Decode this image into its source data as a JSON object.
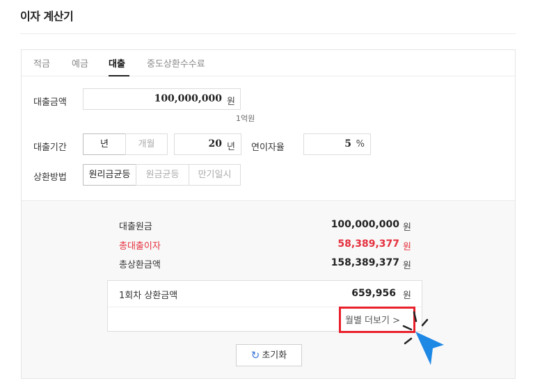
{
  "page": {
    "title": "이자 계산기"
  },
  "tabs": [
    {
      "label": "적금"
    },
    {
      "label": "예금"
    },
    {
      "label": "대출"
    },
    {
      "label": "중도상환수수료"
    }
  ],
  "form": {
    "amount": {
      "label": "대출금액",
      "value": "100,000,000",
      "unit": "원",
      "hint": "1억원"
    },
    "period": {
      "label": "대출기간",
      "unit_options": [
        "년",
        "개월"
      ],
      "selected_unit": "년",
      "value": "20",
      "unit": "년"
    },
    "rate": {
      "label": "연이자율",
      "value": "5",
      "unit": "%"
    },
    "method": {
      "label": "상환방법",
      "options": [
        "원리금균등",
        "원금균등",
        "만기일시"
      ],
      "selected": "원리금균등"
    }
  },
  "result": {
    "principal": {
      "label": "대출원금",
      "value": "100,000,000",
      "unit": "원"
    },
    "interest": {
      "label": "총대출이자",
      "value": "58,389,377",
      "unit": "원"
    },
    "total": {
      "label": "총상환금액",
      "value": "158,389,377",
      "unit": "원"
    },
    "first_payment": {
      "label": "1회차 상환금액",
      "value": "659,956",
      "unit": "원"
    },
    "monthly_more": "월별 더보기 >",
    "reset": "초기화"
  },
  "colors": {
    "accent_red": "#e5303e",
    "highlight": "#e8202a",
    "cursor": "#1e88e5"
  }
}
